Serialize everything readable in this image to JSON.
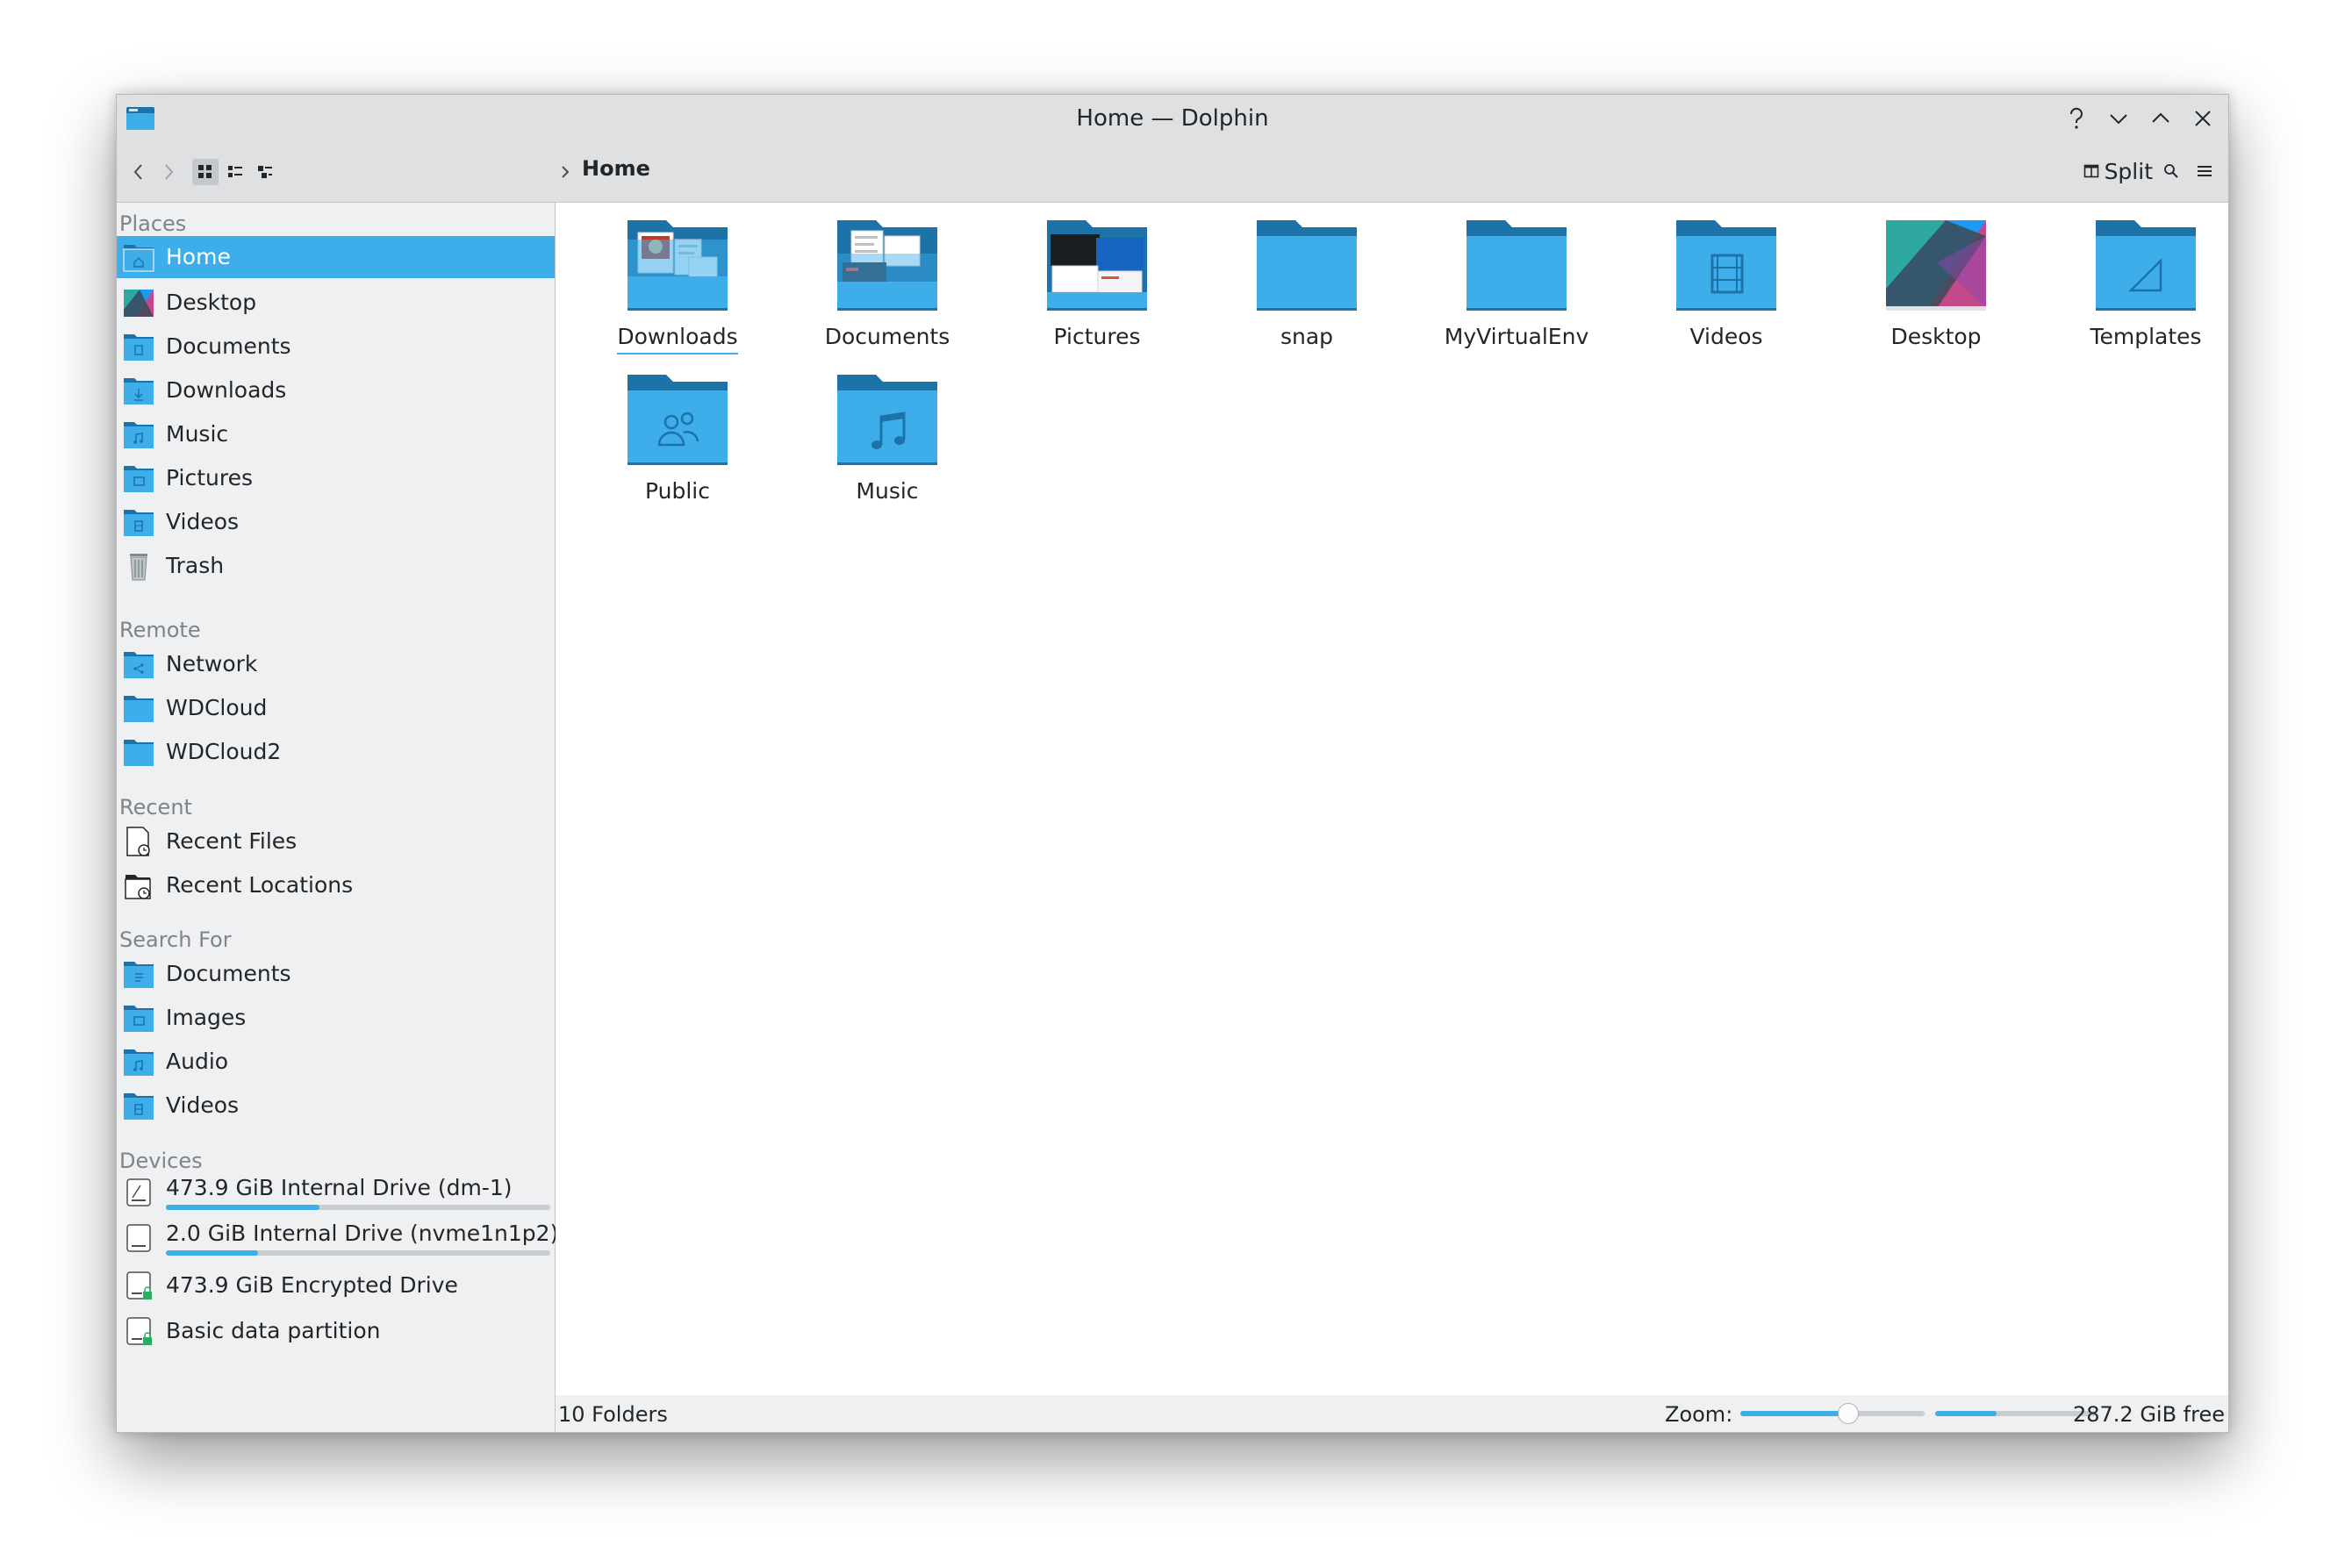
{
  "window": {
    "title": "Home — Dolphin"
  },
  "toolbar": {
    "breadcrumb": "Home",
    "split_label": "Split"
  },
  "sidebar": {
    "sections": [
      {
        "title": "Places",
        "items": [
          {
            "label": "Home",
            "icon": "home-folder-icon",
            "selected": true
          },
          {
            "label": "Desktop",
            "icon": "desktop-folder-icon"
          },
          {
            "label": "Documents",
            "icon": "documents-folder-icon"
          },
          {
            "label": "Downloads",
            "icon": "downloads-folder-icon"
          },
          {
            "label": "Music",
            "icon": "music-folder-icon"
          },
          {
            "label": "Pictures",
            "icon": "pictures-folder-icon"
          },
          {
            "label": "Videos",
            "icon": "videos-folder-icon"
          },
          {
            "label": "Trash",
            "icon": "trash-icon"
          }
        ]
      },
      {
        "title": "Remote",
        "items": [
          {
            "label": "Network",
            "icon": "network-folder-icon"
          },
          {
            "label": "WDCloud",
            "icon": "folder-icon"
          },
          {
            "label": "WDCloud2",
            "icon": "folder-icon"
          }
        ]
      },
      {
        "title": "Recent",
        "items": [
          {
            "label": "Recent Files",
            "icon": "recent-files-icon"
          },
          {
            "label": "Recent Locations",
            "icon": "recent-locations-icon"
          }
        ]
      },
      {
        "title": "Search For",
        "items": [
          {
            "label": "Documents",
            "icon": "search-documents-icon"
          },
          {
            "label": "Images",
            "icon": "search-images-icon"
          },
          {
            "label": "Audio",
            "icon": "search-audio-icon"
          },
          {
            "label": "Videos",
            "icon": "search-videos-icon"
          }
        ]
      },
      {
        "title": "Devices",
        "items": [
          {
            "label": "473.9 GiB Internal Drive (dm-1)",
            "icon": "drive-icon",
            "usage": 0.4
          },
          {
            "label": "2.0 GiB Internal Drive (nvme1n1p2)",
            "icon": "drive-icon",
            "usage": 0.24
          },
          {
            "label": "473.9 GiB Encrypted Drive",
            "icon": "encrypted-drive-icon"
          },
          {
            "label": "Basic data partition",
            "icon": "encrypted-drive-icon"
          }
        ]
      }
    ]
  },
  "content": {
    "items": [
      {
        "name": "Downloads",
        "icon": "downloads-folder-icon"
      },
      {
        "name": "Documents",
        "icon": "documents-folder-icon"
      },
      {
        "name": "Pictures",
        "icon": "pictures-folder-icon"
      },
      {
        "name": "snap",
        "icon": "folder-icon"
      },
      {
        "name": "MyVirtualEnv",
        "icon": "folder-icon"
      },
      {
        "name": "Videos",
        "icon": "videos-folder-icon"
      },
      {
        "name": "Desktop",
        "icon": "desktop-folder-icon"
      },
      {
        "name": "Templates",
        "icon": "templates-folder-icon"
      },
      {
        "name": "Public",
        "icon": "public-folder-icon"
      },
      {
        "name": "Music",
        "icon": "music-folder-icon"
      }
    ]
  },
  "statusbar": {
    "summary": "10 Folders",
    "zoom_label": "Zoom:",
    "zoom_level": 0.58,
    "free_label": "287.2 GiB free",
    "used_fraction": 0.38
  },
  "colors": {
    "accent": "#3daee9",
    "folder": "#3daee9",
    "folder_tab": "#1d72a8",
    "window_bg": "#eff0f1"
  }
}
